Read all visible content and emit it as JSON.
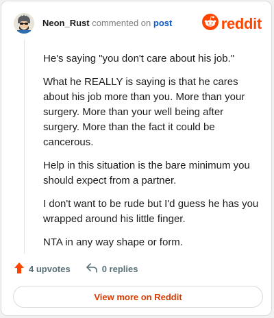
{
  "header": {
    "username": "Neon_Rust",
    "action": "commented on",
    "link_text": "post",
    "brand": "reddit"
  },
  "comment": {
    "paragraphs": [
      "He's saying \"you don't care about his job.\"",
      "What he REALLY is saying is that he cares about his job more than you. More than your surgery. More than your well being after surgery. More than the fact it could be cancerous.",
      "Help in this situation is the bare minimum you should expect from a partner.",
      "I don't want to be rude but I'd guess he has you wrapped around his little finger.",
      "NTA in any way shape or form."
    ]
  },
  "footer": {
    "upvotes": "4 upvotes",
    "replies": "0 replies",
    "cta": "View more on Reddit"
  },
  "colors": {
    "brand": "#ff4500",
    "link": "#0a58ca",
    "cta_text": "#d93a00"
  },
  "icons": {
    "upvote": "upvote-arrow-icon",
    "reply": "reply-arrow-icon",
    "brand": "reddit-logo-icon"
  }
}
